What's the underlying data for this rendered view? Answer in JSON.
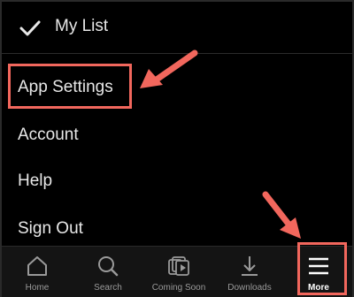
{
  "menu": {
    "my_list_label": "My List",
    "items": [
      {
        "label": "App Settings"
      },
      {
        "label": "Account"
      },
      {
        "label": "Help"
      },
      {
        "label": "Sign Out"
      }
    ]
  },
  "bottom_nav": {
    "items": [
      {
        "label": "Home",
        "icon": "home-icon"
      },
      {
        "label": "Search",
        "icon": "search-icon"
      },
      {
        "label": "Coming Soon",
        "icon": "coming-soon-icon"
      },
      {
        "label": "Downloads",
        "icon": "download-icon"
      },
      {
        "label": "More",
        "icon": "menu-icon",
        "active": true
      }
    ]
  },
  "colors": {
    "background": "#000000",
    "nav_background": "#141414",
    "annotation": "#f2675d",
    "text": "#e8e8e8",
    "nav_text": "#9a9a9a"
  }
}
